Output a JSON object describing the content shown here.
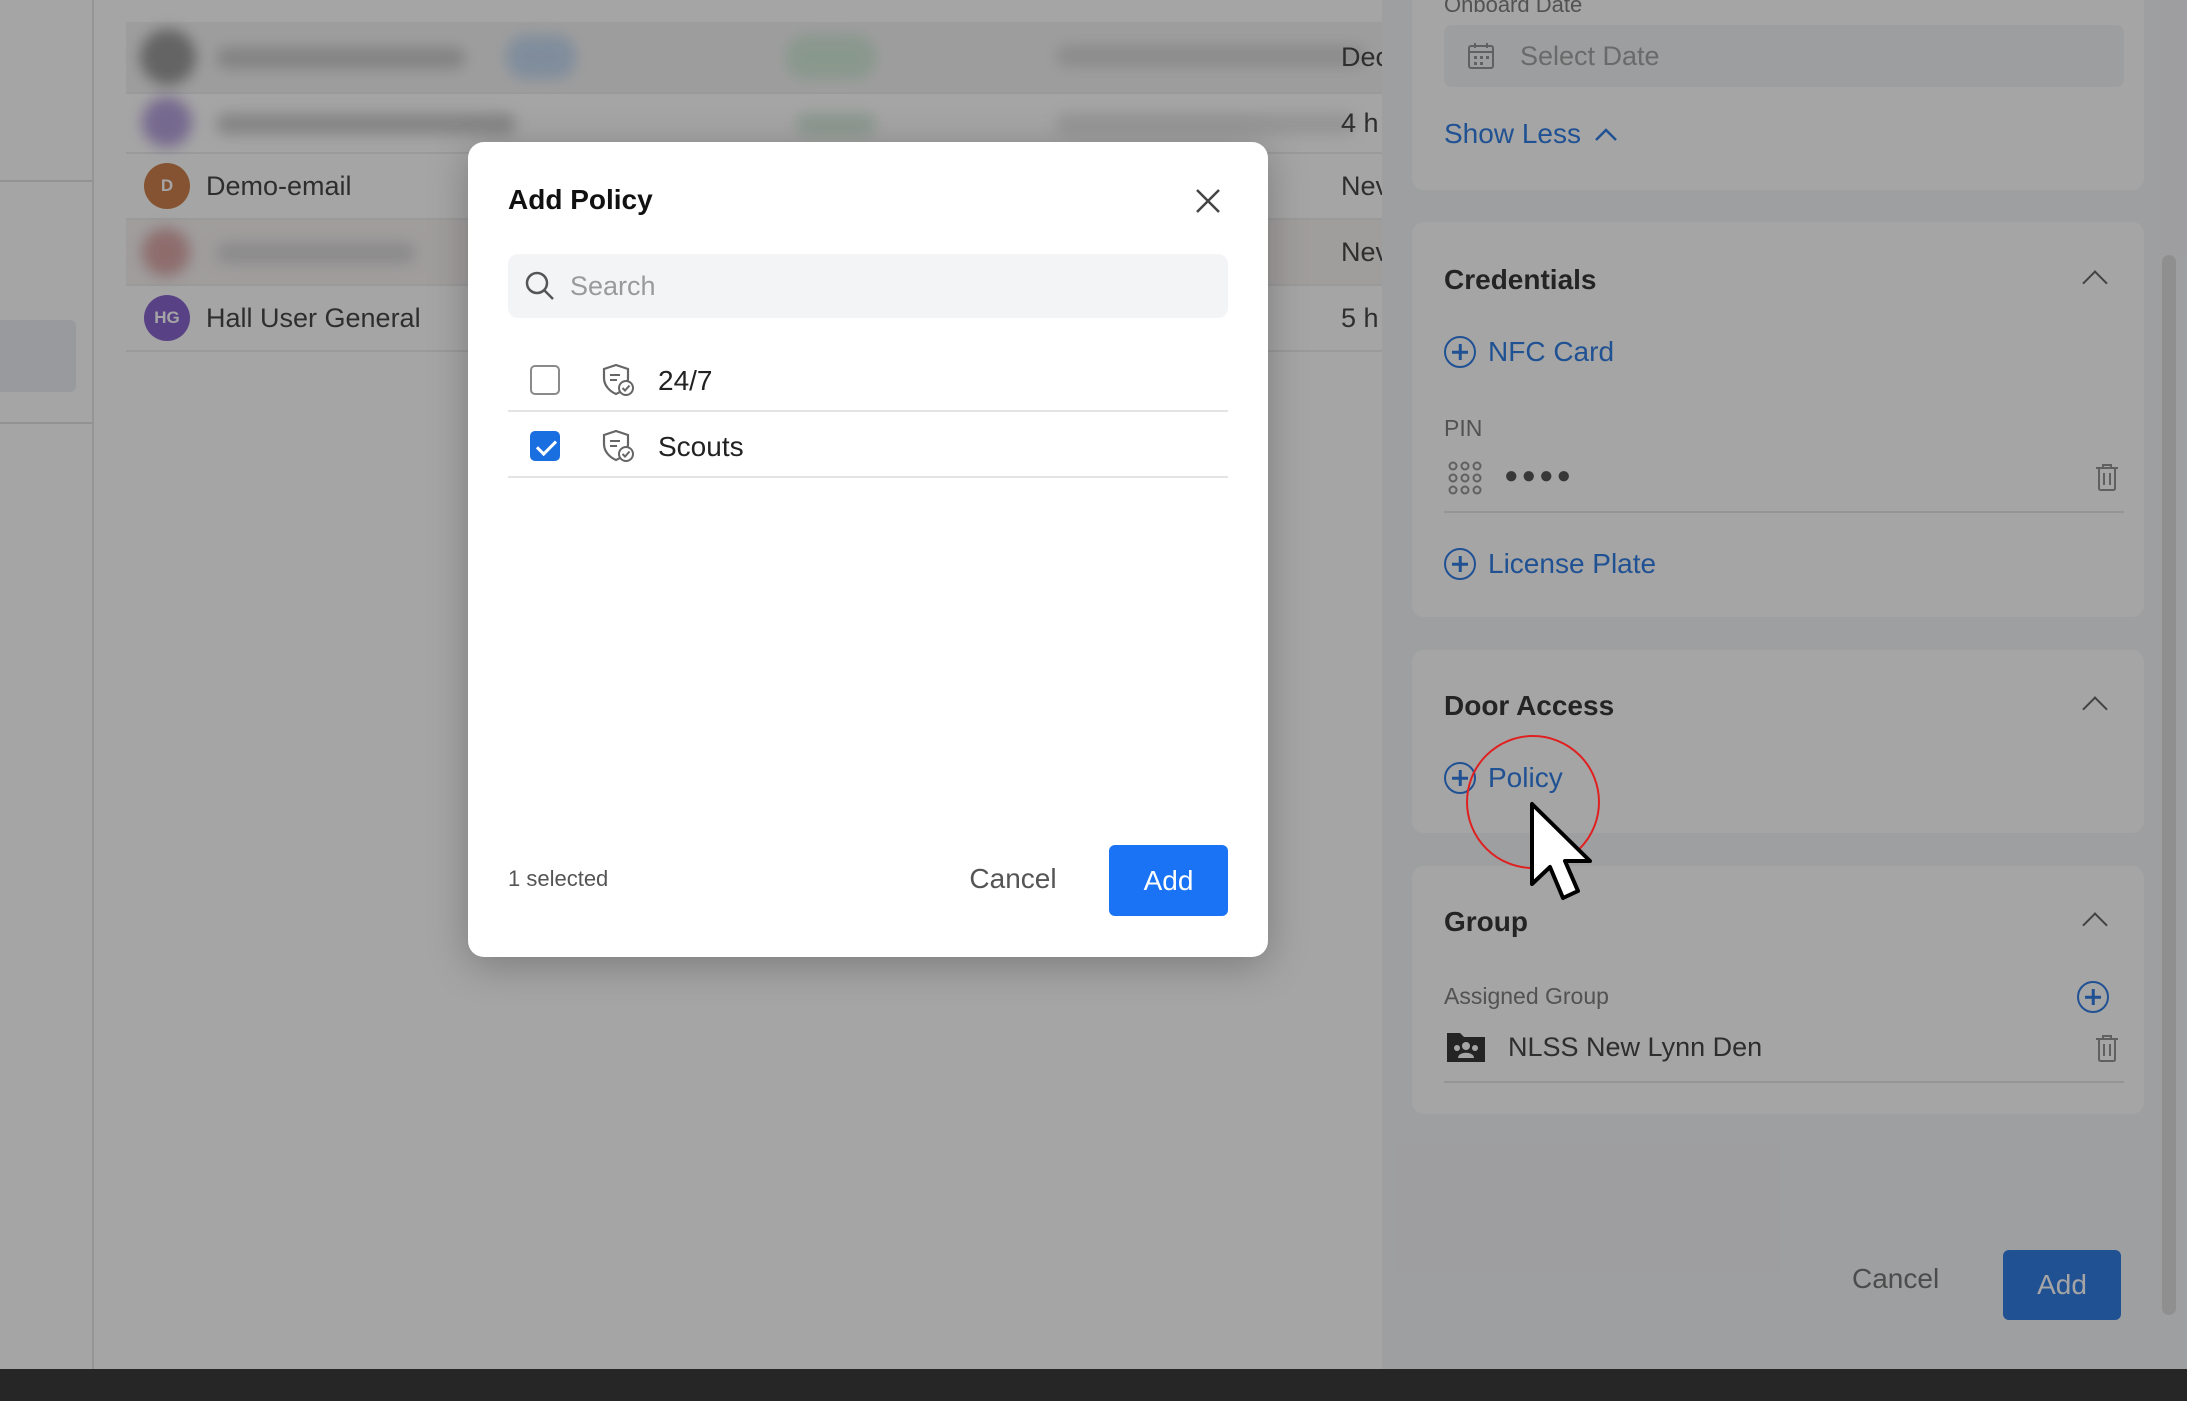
{
  "users": [
    {
      "initials": "D",
      "name": "Demo-email",
      "time": "Nev",
      "avatar_color": "#c8733a"
    },
    {
      "initials": "HG",
      "name": "Hall User General",
      "time": "5 h",
      "avatar_color": "#7b55c8"
    }
  ],
  "table_times": {
    "row0": "Dec",
    "row1": "4 h",
    "row3": "Nev"
  },
  "panel": {
    "onboard_date_label": "Onboard Date",
    "onboard_date_placeholder": "Select Date",
    "show_less": "Show Less",
    "credentials_title": "Credentials",
    "nfc_card": "NFC Card",
    "pin_label": "PIN",
    "pin_value": "●●●●",
    "license_plate": "License Plate",
    "door_access_title": "Door Access",
    "policy_link": "Policy",
    "group_title": "Group",
    "assigned_group_label": "Assigned Group",
    "assigned_group_value": "NLSS New Lynn Den",
    "cancel": "Cancel",
    "add": "Add"
  },
  "modal": {
    "title": "Add Policy",
    "search_placeholder": "Search",
    "policies": [
      {
        "name": "24/7",
        "checked": false
      },
      {
        "name": "Scouts",
        "checked": true
      }
    ],
    "selected_count": "1 selected",
    "cancel": "Cancel",
    "add": "Add"
  },
  "colors": {
    "accent": "#1a73f5",
    "link": "#1a6fe0",
    "highlight_ring": "#e02020"
  }
}
